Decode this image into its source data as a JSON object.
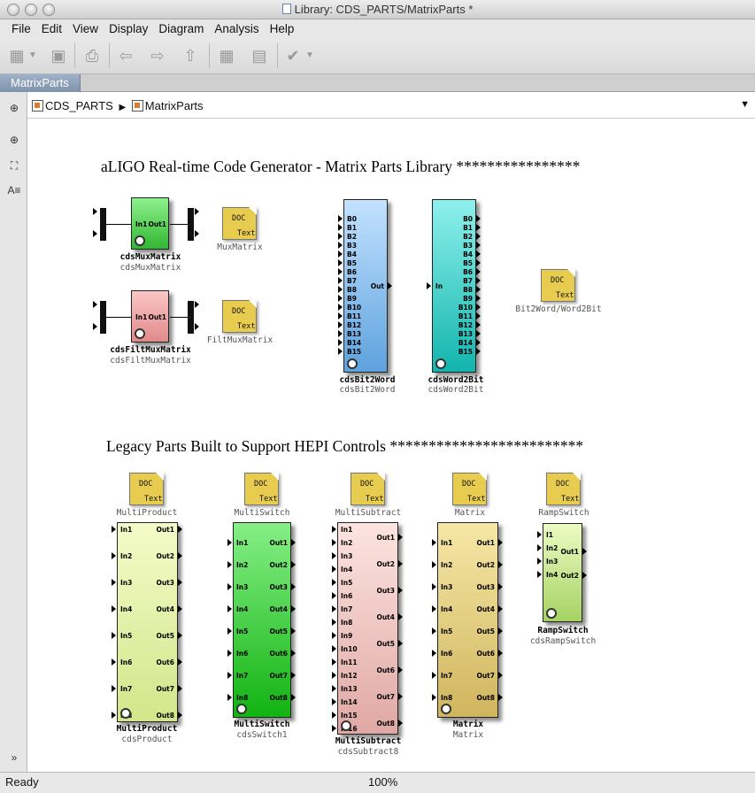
{
  "window": {
    "title": "Library: CDS_PARTS/MatrixParts *"
  },
  "menu": [
    "File",
    "Edit",
    "View",
    "Display",
    "Diagram",
    "Analysis",
    "Help"
  ],
  "tab": {
    "label": "MatrixParts"
  },
  "breadcrumb": {
    "root": "CDS_PARTS",
    "current": "MatrixParts"
  },
  "headings": {
    "aligo": "aLIGO Real-time Code Generator - Matrix Parts Library ****************",
    "legacy": "Legacy Parts Built to Support HEPI Controls *************************"
  },
  "doc": {
    "line1": "DOC",
    "line2": "Text"
  },
  "docs": {
    "muxmatrix": "MuxMatrix",
    "filtmuxmatrix": "FiltMuxMatrix",
    "bit2word": "Bit2Word/Word2Bit",
    "multiproduct": "MultiProduct",
    "multiswitch": "MultiSwitch",
    "multisubtract": "MultiSubtract",
    "matrix": "Matrix",
    "rampswitch": "RampSwitch"
  },
  "blocks": {
    "muxmatrix": {
      "name": "cdsMuxMatrix",
      "sub": "cdsMuxMatrix",
      "in": "In1",
      "out": "Out1"
    },
    "filtmux": {
      "name": "cdsFiltMuxMatrix",
      "sub": "cdsFiltMuxMatrix",
      "in": "In1",
      "out": "Out1"
    },
    "bit2word": {
      "name": "cdsBit2Word",
      "sub": "cdsBit2Word",
      "inputs": [
        "B0",
        "B1",
        "B2",
        "B3",
        "B4",
        "B5",
        "B6",
        "B7",
        "B8",
        "B9",
        "B10",
        "B11",
        "B12",
        "B13",
        "B14",
        "B15"
      ],
      "out": "Out"
    },
    "word2bit": {
      "name": "cdsWord2Bit",
      "sub": "cdsWord2Bit",
      "in": "In",
      "outputs": [
        "B0",
        "B1",
        "B2",
        "B3",
        "B4",
        "B5",
        "B6",
        "B7",
        "B8",
        "B9",
        "B10",
        "B11",
        "B12",
        "B13",
        "B14",
        "B15"
      ]
    },
    "multiproduct": {
      "name": "MultiProduct",
      "sub": "cdsProduct",
      "inputs": [
        "In1",
        "In2",
        "In3",
        "In4",
        "In5",
        "In6",
        "In7",
        "In8"
      ],
      "outputs": [
        "Out1",
        "Out2",
        "Out3",
        "Out4",
        "Out5",
        "Out6",
        "Out7",
        "Out8"
      ]
    },
    "multiswitch": {
      "name": "MultiSwitch",
      "sub": "cdsSwitch1",
      "inputs": [
        "In1",
        "In2",
        "In3",
        "In4",
        "In5",
        "In6",
        "In7",
        "In8"
      ],
      "outputs": [
        "Out1",
        "Out2",
        "Out3",
        "Out4",
        "Out5",
        "Out6",
        "Out7",
        "Out8"
      ]
    },
    "multisubtract": {
      "name": "MultiSubtract",
      "sub": "cdsSubtract8",
      "inputs": [
        "In1",
        "In2",
        "In3",
        "In4",
        "In5",
        "In6",
        "In7",
        "In8",
        "In9",
        "In10",
        "In11",
        "In12",
        "In13",
        "In14",
        "In15",
        "In16"
      ],
      "outputs": [
        "Out1",
        "Out2",
        "Out3",
        "Out4",
        "Out5",
        "Out6",
        "Out7",
        "Out8"
      ]
    },
    "matrix": {
      "name": "Matrix",
      "sub": "Matrix",
      "inputs": [
        "In1",
        "In2",
        "In3",
        "In4",
        "In5",
        "In6",
        "In7",
        "In8"
      ],
      "outputs": [
        "Out1",
        "Out2",
        "Out3",
        "Out4",
        "Out5",
        "Out6",
        "Out7",
        "Out8"
      ]
    },
    "rampswitch": {
      "name": "RampSwitch",
      "sub": "cdsRampSwitch",
      "inputs": [
        "I1",
        "In2",
        "In3",
        "In4"
      ],
      "outputs": [
        "Out1",
        "Out2"
      ]
    }
  },
  "status": {
    "left": "Ready",
    "zoom": "100%"
  },
  "colors": {
    "green": "#5cd35c",
    "pink": "#f4b0b0",
    "blue": "#a7cff3",
    "cyan": "#6fe0dc",
    "yellowgreen": "#eef8b0",
    "pinklight": "#f9d6d2",
    "tan": "#eed98c",
    "doc": "#e8cc50"
  }
}
